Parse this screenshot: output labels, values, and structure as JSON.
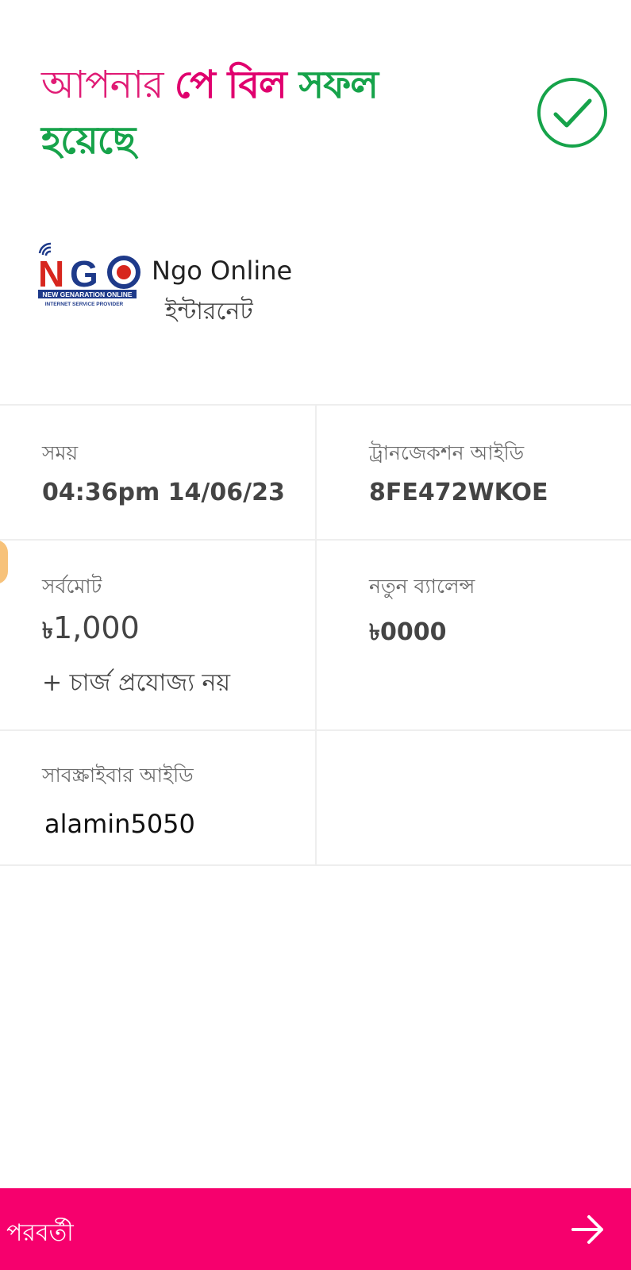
{
  "header": {
    "title_part1": "আপনার ",
    "title_part2": "পে বিল ",
    "title_part3": " সফল",
    "title_part4": "হয়েছে"
  },
  "merchant": {
    "logo_letters": "NGO",
    "logo_line1": "NEW GENARATION ONLINE",
    "logo_line2": "INTERNET SERVICE PROVIDER",
    "name": "Ngo Online",
    "type": "ইন্টারনেট"
  },
  "details": {
    "time_label": "সময়",
    "time_value": "04:36pm 14/06/23",
    "trx_label": "ট্রানজেকশন আইডি",
    "trx_value": "8FE472WKOE",
    "total_label": "সর্বমোট",
    "currency_symbol": "৳",
    "total_value": "1,000",
    "charge_note": "+ চার্জ প্রযোজ্য নয়",
    "balance_label": "নতুন ব্যালেন্স",
    "balance_value": "0000",
    "subscriber_label": "সাবস্ক্রাইবার আইডি",
    "subscriber_value": "alamin5050"
  },
  "footer": {
    "next_label": "পরবর্তী"
  },
  "colors": {
    "brand_pink": "#f6006d",
    "success_green": "#16a34a"
  },
  "icons": {
    "success": "check-circle-icon",
    "next": "arrow-right-icon"
  }
}
